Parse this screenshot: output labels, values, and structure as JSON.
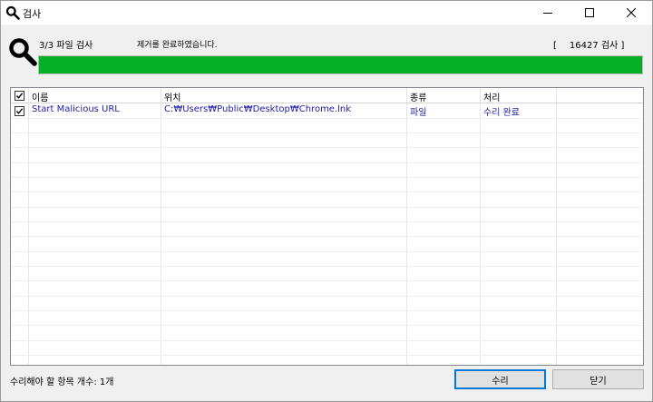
{
  "window": {
    "title": "검사"
  },
  "scan": {
    "progress_label": "3/3 파일 검사",
    "status": "제거를 완료하였습니다.",
    "count_open": "[",
    "count_value": "16427",
    "count_unit": "검사 ]",
    "progress_percent": 100,
    "progress_color": "#06b025"
  },
  "list": {
    "columns": [
      "이름",
      "위치",
      "종류",
      "처리"
    ],
    "rows": [
      {
        "checked": true,
        "name": "Start Malicious URL",
        "location": "C:₩Users₩Public₩Desktop₩Chrome.lnk",
        "type": "파일",
        "action": "수리 완료"
      }
    ],
    "header_checked": true,
    "row_text_color": "#1c1ca8"
  },
  "footer": {
    "repair_count": "수리해야 할 항목 개수: 1개",
    "repair_button": "수리",
    "close_button": "닫기"
  },
  "icons": [
    "search-icon",
    "minimize-icon",
    "maximize-icon",
    "close-icon",
    "checkbox-checked-icon"
  ]
}
